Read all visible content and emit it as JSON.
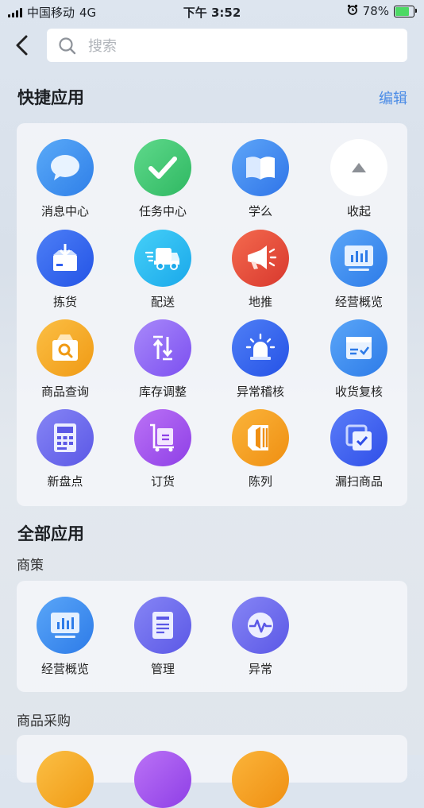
{
  "status_bar": {
    "carrier": "中国移动",
    "network": "4G",
    "time": "下午 3:52",
    "battery": "78%"
  },
  "search": {
    "placeholder": "搜索"
  },
  "quick_apps": {
    "title": "快捷应用",
    "edit_label": "编辑",
    "items": [
      {
        "label": "消息中心",
        "icon": "message-bubble-icon",
        "color": "#3b8ff0"
      },
      {
        "label": "任务中心",
        "icon": "checkmark-icon",
        "color": "#34c26a"
      },
      {
        "label": "学么",
        "icon": "book-icon",
        "color": "#3d86f2"
      },
      {
        "label": "收起",
        "icon": "collapse-arrow-icon",
        "color": "#ffffff"
      },
      {
        "label": "拣货",
        "icon": "box-download-icon",
        "color": "#2f64f0"
      },
      {
        "label": "配送",
        "icon": "delivery-truck-icon",
        "color": "#22b8f0"
      },
      {
        "label": "地推",
        "icon": "megaphone-icon",
        "color": "#e8473a"
      },
      {
        "label": "经营概览",
        "icon": "bar-chart-monitor-icon",
        "color": "#3a8bf2"
      },
      {
        "label": "商品查询",
        "icon": "product-search-icon",
        "color": "#f5a623"
      },
      {
        "label": "库存调整",
        "icon": "up-down-arrows-icon",
        "color": "#8d5ff0"
      },
      {
        "label": "异常稽核",
        "icon": "alarm-light-icon",
        "color": "#2f62ec"
      },
      {
        "label": "收货复核",
        "icon": "receipt-check-icon",
        "color": "#3a8ff2"
      },
      {
        "label": "新盘点",
        "icon": "calculator-icon",
        "color": "#6a68ec"
      },
      {
        "label": "订货",
        "icon": "cart-order-icon",
        "color": "#a052ee"
      },
      {
        "label": "陈列",
        "icon": "shelf-display-icon",
        "color": "#f5a020"
      },
      {
        "label": "漏扫商品",
        "icon": "missed-scan-icon",
        "color": "#3c5cf0"
      }
    ]
  },
  "all_apps": {
    "title": "全部应用",
    "groups": [
      {
        "name": "商策",
        "items": [
          {
            "label": "经营概览",
            "icon": "bar-chart-monitor-icon",
            "color": "#3a8bf2"
          },
          {
            "label": "管理",
            "icon": "document-icon",
            "color": "#6a68ec"
          },
          {
            "label": "异常",
            "icon": "pulse-icon",
            "color": "#6a68ec"
          }
        ]
      },
      {
        "name": "商品采购",
        "items": [
          {
            "label": "",
            "icon": "app-icon",
            "color": "#f5a623"
          },
          {
            "label": "",
            "icon": "app-icon",
            "color": "#a052ee"
          },
          {
            "label": "",
            "icon": "app-icon",
            "color": "#f5a623"
          }
        ]
      }
    ]
  }
}
